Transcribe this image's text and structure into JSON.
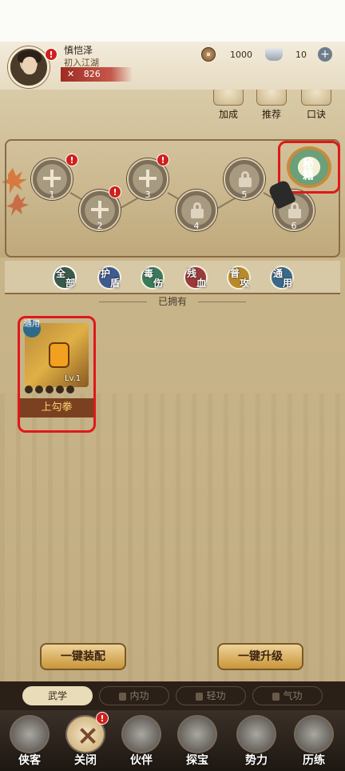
{
  "player": {
    "name": "慎恺泽",
    "rank": "初入江湖",
    "power": "826",
    "badge": "!"
  },
  "resources": {
    "coins": "1000",
    "ingots": "10",
    "plus": "+"
  },
  "top_buttons": [
    {
      "label": "加成"
    },
    {
      "label": "推荐"
    },
    {
      "label": "口诀"
    }
  ],
  "slots": [
    {
      "num": "1",
      "state": "add",
      "alert": "!"
    },
    {
      "num": "2",
      "state": "add",
      "alert": "!"
    },
    {
      "num": "3",
      "state": "add",
      "alert": "!"
    },
    {
      "num": "4",
      "state": "locked"
    },
    {
      "num": "5",
      "state": "locked"
    },
    {
      "num": "6",
      "state": "locked"
    }
  ],
  "quick_equip": {
    "label": "秘籍"
  },
  "filter_tabs": [
    {
      "c1": "全",
      "c2": "部",
      "color": "#3a5a4a"
    },
    {
      "c1": "护",
      "c2": "盾",
      "color": "#3f5a8e"
    },
    {
      "c1": "毒",
      "c2": "伤",
      "color": "#3a7a5a"
    },
    {
      "c1": "残",
      "c2": "血",
      "color": "#9a3a3a"
    },
    {
      "c1": "普",
      "c2": "攻",
      "color": "#b88a2a"
    },
    {
      "c1": "通",
      "c2": "用",
      "color": "#3a6a8a"
    }
  ],
  "owned_label": "已拥有",
  "skill": {
    "type": "通用",
    "level": "Lv.1",
    "name": "上勾拳"
  },
  "actions": {
    "equip_all": "一键装配",
    "upgrade_all": "一键升级"
  },
  "bottom_tabs": [
    {
      "label": "武学",
      "locked": false
    },
    {
      "label": "内功",
      "locked": true
    },
    {
      "label": "轻功",
      "locked": true
    },
    {
      "label": "气功",
      "locked": true
    }
  ],
  "nav": [
    {
      "label": "侠客"
    },
    {
      "label": "关闭",
      "alert": "!"
    },
    {
      "label": "伙伴"
    },
    {
      "label": "探宝"
    },
    {
      "label": "势力"
    },
    {
      "label": "历练"
    }
  ]
}
